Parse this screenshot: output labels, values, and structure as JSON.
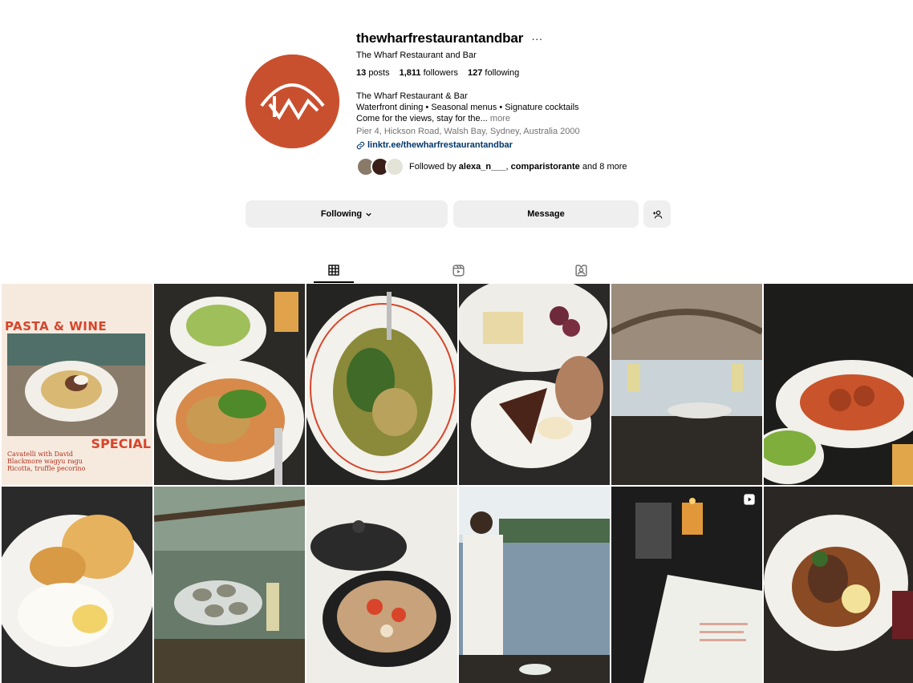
{
  "profile": {
    "username": "thewharfrestaurantandbar",
    "more": "···",
    "full_name": "The Wharf Restaurant and Bar",
    "stats": {
      "posts_count": "13",
      "posts_label": "posts",
      "followers_count": "1,811",
      "followers_label": "followers",
      "following_count": "127",
      "following_label": "following"
    },
    "bio": {
      "line1": "The Wharf Restaurant & Bar",
      "line2": "Waterfront dining • Seasonal menus • Signature cocktails",
      "line3": "Come for the views, stay for the...",
      "more": "more",
      "address": "Pier 4, Hickson Road, Walsh Bay, Sydney, Australia 2000",
      "link": "linktr.ee/thewharfrestaurantandbar"
    },
    "followed_by": {
      "prefix": "Followed by",
      "user1": "alexa_n___",
      "separator": ",",
      "user2": "comparistorante",
      "suffix": "and 8 more"
    }
  },
  "actions": {
    "following": "Following",
    "message": "Message"
  },
  "tabs": [
    {
      "name": "posts",
      "icon": "grid-icon",
      "active": true
    },
    {
      "name": "reels",
      "icon": "reels-icon",
      "active": false
    },
    {
      "name": "tagged",
      "icon": "tagged-icon",
      "active": false
    }
  ],
  "posts": [
    {
      "kind": "poster",
      "title": "PASTA & WINE",
      "subtitle": "SPECIAL",
      "caption_lines": [
        "Cavatelli with David",
        "Blackmore wagyu ragu",
        "Ricotta, truffle pecorino"
      ]
    },
    {
      "kind": "photo",
      "subject": "chicken-with-peas"
    },
    {
      "kind": "photo",
      "subject": "grilled-salad"
    },
    {
      "kind": "photo",
      "subject": "cheese-and-dessert"
    },
    {
      "kind": "photo",
      "subject": "harbour-bridge-wine"
    },
    {
      "kind": "photo",
      "subject": "meatball-dish"
    },
    {
      "kind": "photo",
      "subject": "chips-and-burrata"
    },
    {
      "kind": "photo",
      "subject": "oysters-champagne"
    },
    {
      "kind": "photo",
      "subject": "cast-iron-pot"
    },
    {
      "kind": "photo",
      "subject": "waiter-pouring-wine"
    },
    {
      "kind": "reel",
      "subject": "menu-candle",
      "badge": "reel-icon"
    },
    {
      "kind": "photo",
      "subject": "braised-meat"
    }
  ],
  "colors": {
    "brand": "#c9502f",
    "link": "#00376b",
    "button_bg": "#efefef",
    "muted_text": "#737373"
  }
}
